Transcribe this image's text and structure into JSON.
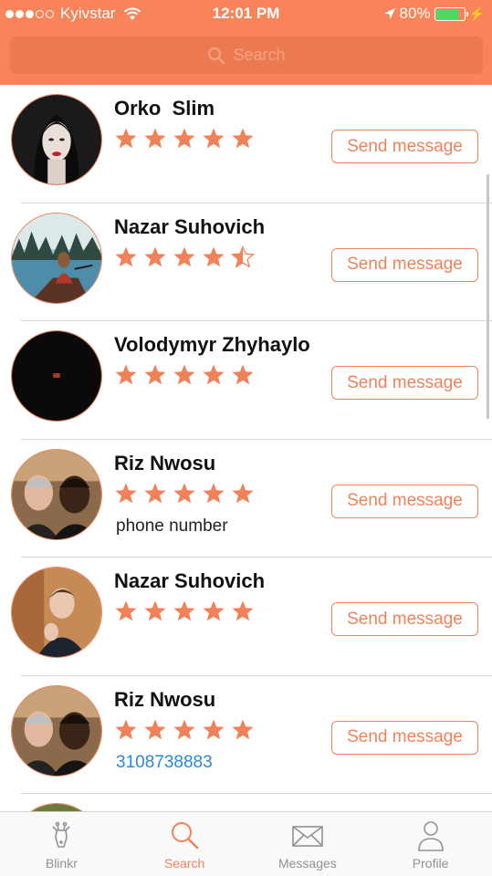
{
  "status_bar": {
    "carrier": "Kyivstar",
    "time": "12:01 PM",
    "battery": "80%"
  },
  "search": {
    "placeholder": "Search"
  },
  "colors": {
    "accent": "#f9845a",
    "star": "#f0825a",
    "phone_link": "#2a88d8"
  },
  "contacts": [
    {
      "name": "Orko  Slim",
      "rating": 5,
      "subtitle": "",
      "button": "Send message"
    },
    {
      "name": "Nazar Suhovich",
      "rating": 4.5,
      "subtitle": "",
      "button": "Send message"
    },
    {
      "name": "Volodymyr Zhyhaylo",
      "rating": 5,
      "subtitle": "",
      "button": "Send message"
    },
    {
      "name": "Riz Nwosu",
      "rating": 5,
      "subtitle": "phone number",
      "button": "Send message"
    },
    {
      "name": "Nazar Suhovich",
      "rating": 5,
      "subtitle": "",
      "button": "Send message"
    },
    {
      "name": "Riz Nwosu",
      "rating": 5,
      "subtitle": "3108738883",
      "button": "Send message"
    }
  ],
  "tabs": [
    {
      "label": "Blinkr",
      "icon": "giraffe-icon"
    },
    {
      "label": "Search",
      "icon": "search-icon",
      "active": true
    },
    {
      "label": "Messages",
      "icon": "envelope-icon"
    },
    {
      "label": "Profile",
      "icon": "person-icon"
    }
  ]
}
